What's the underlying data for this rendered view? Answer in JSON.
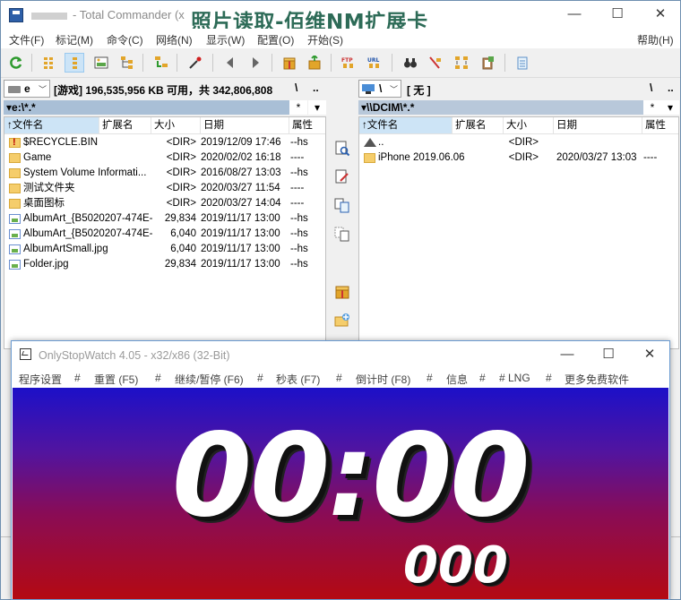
{
  "tc": {
    "title": "Total Commander (x",
    "title_prefix": "-",
    "overlay_caption": "照片读取-佰维NM扩展卡",
    "window_controls": {
      "minimize": "—",
      "maximize": "☐",
      "close": "✕"
    },
    "menu": [
      "文件(F)",
      "标记(M)",
      "命令(C)",
      "网络(N)",
      "显示(W)",
      "配置(O)",
      "开始(S)",
      "帮助(H)"
    ]
  },
  "left": {
    "drive_letter": "e",
    "drive_info": "[游戏]  196,535,956 KB 可用，共 342,806,808",
    "root_btn": "\\",
    "up_btn": "..",
    "path": "e:\\*.*",
    "hist": "*",
    "columns": [
      "文件名",
      "扩展名",
      "大小",
      "日期",
      "属性"
    ],
    "rows": [
      {
        "icon": "sys",
        "name": "$RECYCLE.BIN",
        "size": "<DIR>",
        "date": "2019/12/09 17:46",
        "attr": "--hs"
      },
      {
        "icon": "folder",
        "name": "Game",
        "size": "<DIR>",
        "date": "2020/02/02 16:18",
        "attr": "----"
      },
      {
        "icon": "folder",
        "name": "System Volume Informati...",
        "size": "<DIR>",
        "date": "2016/08/27 13:03",
        "attr": "--hs"
      },
      {
        "icon": "folder",
        "name": "测试文件夹",
        "size": "<DIR>",
        "date": "2020/03/27 11:54",
        "attr": "----"
      },
      {
        "icon": "folder",
        "name": "桌面图标",
        "size": "<DIR>",
        "date": "2020/03/27 14:04",
        "attr": "----"
      },
      {
        "icon": "image",
        "name": "AlbumArt_{B5020207-474E-...",
        "size": "29,834",
        "date": "2019/11/17 13:00",
        "attr": "--hs"
      },
      {
        "icon": "image",
        "name": "AlbumArt_{B5020207-474E-4...",
        "size": "6,040",
        "date": "2019/11/17 13:00",
        "attr": "--hs"
      },
      {
        "icon": "image",
        "name": "AlbumArtSmall.jpg",
        "size": "6,040",
        "date": "2019/11/17 13:00",
        "attr": "--hs"
      },
      {
        "icon": "image",
        "name": "Folder.jpg",
        "size": "29,834",
        "date": "2019/11/17 13:00",
        "attr": "--hs"
      }
    ]
  },
  "right": {
    "drive_letter": "\\",
    "drive_info": "[ 无 ]",
    "root_btn": "\\",
    "up_btn": "..",
    "path": "\\\\DCIM\\*.*",
    "hist": "*",
    "columns": [
      "文件名",
      "扩展名",
      "大小",
      "日期",
      "属性"
    ],
    "rows": [
      {
        "icon": "up",
        "name": "..",
        "size": "<DIR>",
        "date": "",
        "attr": ""
      },
      {
        "icon": "folder",
        "name": "iPhone 2019.06.06",
        "size": "<DIR>",
        "date": "2020/03/27 13:03",
        "attr": "----"
      }
    ]
  },
  "stopwatch": {
    "title": "OnlyStopWatch 4.05 - x32/x86 (32-Bit)",
    "window_controls": {
      "minimize": "—",
      "maximize": "☐",
      "close": "✕"
    },
    "menu": [
      "程序设置",
      "#",
      "重置 (F5)",
      "#",
      "继续/暂停 (F6)",
      "#",
      "秒表 (F7)",
      "#",
      "倒计时 (F8)",
      "#",
      "信息",
      "#",
      "# LNG",
      "#",
      "更多免费软件"
    ],
    "time": "00:00",
    "ms": "000"
  }
}
